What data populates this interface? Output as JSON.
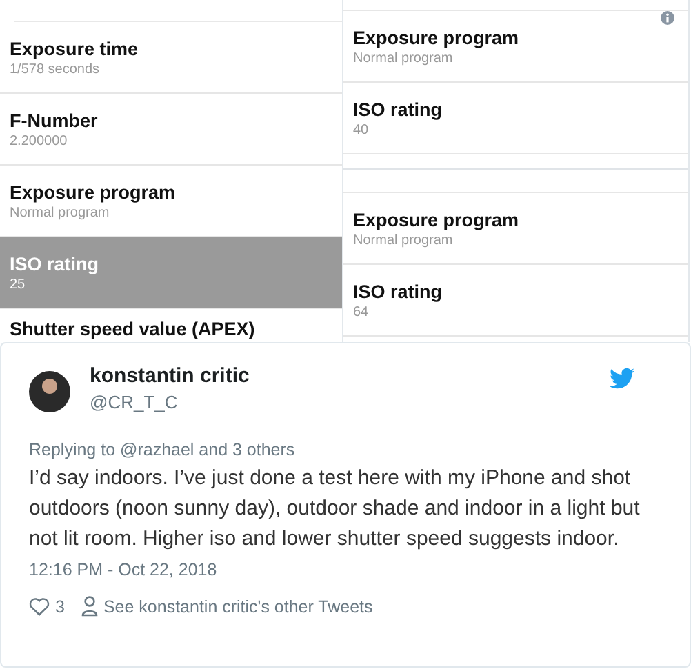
{
  "screenshots": [
    {
      "rows": [
        {
          "title": "Exposure time",
          "value": "1/578 seconds",
          "selected": false
        },
        {
          "title": "F-Number",
          "value": "2.200000",
          "selected": false
        },
        {
          "title": "Exposure program",
          "value": "Normal program",
          "selected": false
        },
        {
          "title": "ISO rating",
          "value": "25",
          "selected": true
        },
        {
          "title": "Shutter speed value (APEX)",
          "selected": false
        }
      ]
    },
    {
      "sections": [
        [
          {
            "title": "Exposure program",
            "value": "Normal program",
            "selected": false
          },
          {
            "title": "ISO rating",
            "value": "40",
            "selected": false
          }
        ],
        [
          {
            "title": "Exposure program",
            "value": "Normal program",
            "selected": false
          },
          {
            "title": "ISO rating",
            "value": "64",
            "selected": false
          }
        ]
      ]
    }
  ],
  "tweet": {
    "name": "konstantin critic",
    "handle": "@CR_T_C",
    "replying": "Replying to @razhael and 3 others",
    "text": "I’d say indoors. I’ve just done a test here with my iPhone and shot outdoors (noon sunny day), outdoor shade and indoor in a light but not lit room. Higher iso and lower shutter speed suggests indoor.",
    "time": "12:16 PM - Oct 22, 2018",
    "likes": "3",
    "see_more": "See konstantin critic's other Tweets"
  }
}
